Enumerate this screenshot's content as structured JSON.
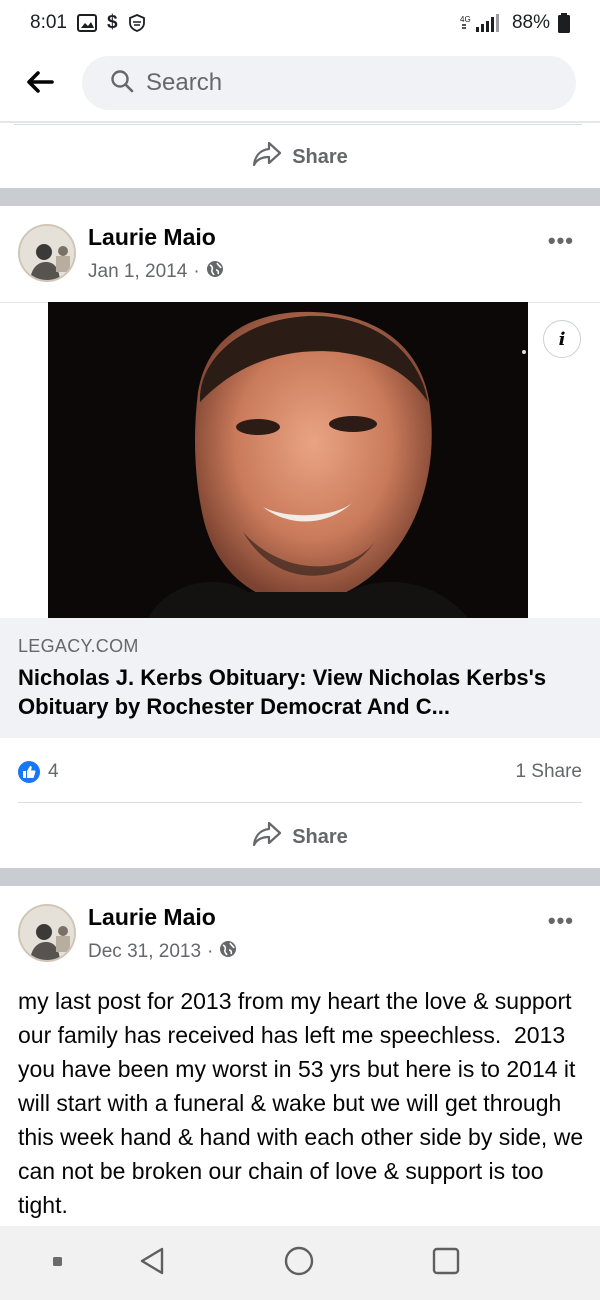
{
  "status_bar": {
    "time": "8:01",
    "battery": "88%",
    "icons": [
      "image-icon",
      "dollar-icon",
      "shield-icon",
      "signal-icon",
      "battery-icon"
    ]
  },
  "search": {
    "placeholder": "Search"
  },
  "share_action_label": "Share",
  "posts": [
    {
      "author": "Laurie Maio",
      "date": "Jan 1, 2014",
      "separator": "·",
      "privacy_icon": "globe-icon",
      "link": {
        "domain": "LEGACY.COM",
        "title": "Nicholas J. Kerbs Obituary: View Nicholas Kerbs's Obituary by Rochester Democrat And C..."
      },
      "reactions_count": "4",
      "shares_count": "1 Share"
    },
    {
      "author": "Laurie Maio",
      "date": "Dec 31, 2013",
      "separator": "·",
      "privacy_icon": "globe-icon",
      "text": "my last post for 2013 from my heart the love & support our family has received has left me speechless.  2013 you have been my worst in 53 yrs but here is to 2014 it will start with a funeral & wake but we will get through this week hand & hand with each other side by side, we can not be broken our chain of love & support is too tight."
    }
  ],
  "colors": {
    "accent": "#1877f2",
    "secondary_text": "#65676b",
    "section_gap": "#c9ccd1"
  }
}
